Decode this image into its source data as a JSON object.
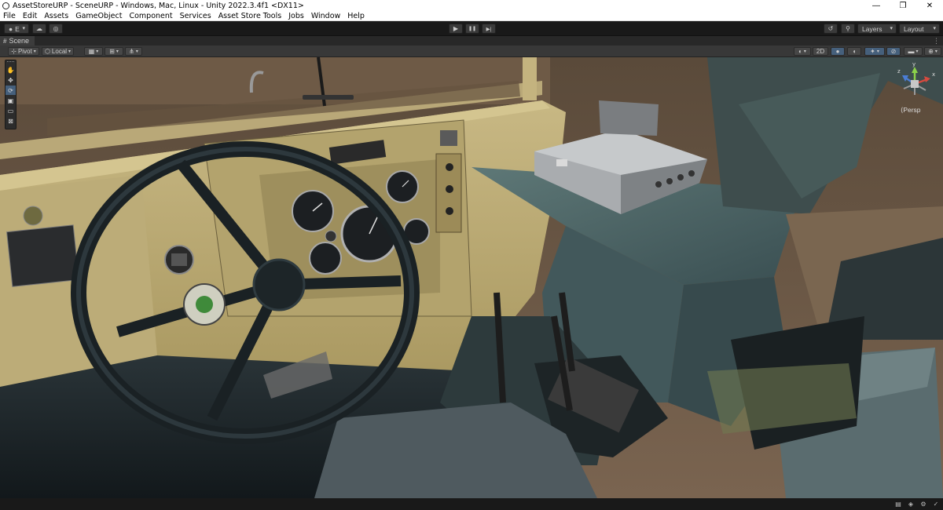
{
  "window": {
    "title": "AssetStoreURP - SceneURP - Windows, Mac, Linux - Unity 2022.3.4f1 <DX11>",
    "minimize": "—",
    "maximize": "❐",
    "close": "✕"
  },
  "menu": [
    "File",
    "Edit",
    "Assets",
    "GameObject",
    "Component",
    "Services",
    "Asset Store Tools",
    "Jobs",
    "Window",
    "Help"
  ],
  "toolbar": {
    "account_label": "E",
    "play": "▶",
    "pause": "❚❚",
    "step": "▶|",
    "layers_label": "Layers",
    "layout_label": "Layout"
  },
  "tab": {
    "scene_label": "Scene",
    "menu_glyph": "⋮"
  },
  "scene_toolbar": {
    "pivot_label": "Pivot",
    "local_label": "Local",
    "mode_2d": "2D"
  },
  "viewport": {
    "camera_mode": "Persp",
    "gizmo_y_label": "y",
    "gizmo_x_label": "x",
    "gizmo_z_label": "z",
    "accent_color": "#46607c"
  }
}
